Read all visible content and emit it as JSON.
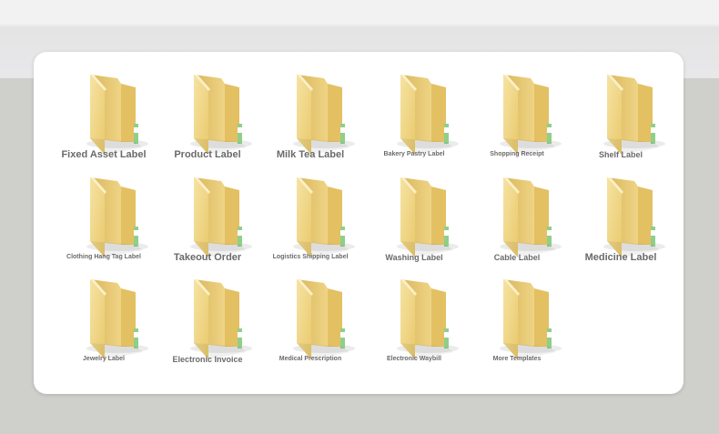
{
  "template_folders": [
    {
      "label": "Fixed Asset Label",
      "size": "lg"
    },
    {
      "label": "Product Label",
      "size": "lg"
    },
    {
      "label": "Milk Tea Label",
      "size": "lg"
    },
    {
      "label": "Bakery Pastry Label",
      "size": "sm"
    },
    {
      "label": "Shopping Receipt",
      "size": "sm"
    },
    {
      "label": "Shelf Label",
      "size": "mid"
    },
    {
      "label": "Clothing Hang Tag Label",
      "size": "sm"
    },
    {
      "label": "Takeout Order",
      "size": "lg"
    },
    {
      "label": "Logistics Shipping Label",
      "size": "sm"
    },
    {
      "label": "Washing Label",
      "size": "mid"
    },
    {
      "label": "Cable Label",
      "size": "mid"
    },
    {
      "label": "Medicine Label",
      "size": "lg"
    },
    {
      "label": "Jewelry Label",
      "size": "sm"
    },
    {
      "label": "Electronic Invoice",
      "size": "mid"
    },
    {
      "label": "Medical Prescription",
      "size": "sm"
    },
    {
      "label": "Electronic Waybill",
      "size": "sm"
    },
    {
      "label": "More Templates",
      "size": "sm"
    }
  ],
  "icon": "folder-icon",
  "colors": {
    "folder_front": "#f3d98b",
    "folder_back": "#e8c96f",
    "label_text": "#6a6a6a"
  }
}
